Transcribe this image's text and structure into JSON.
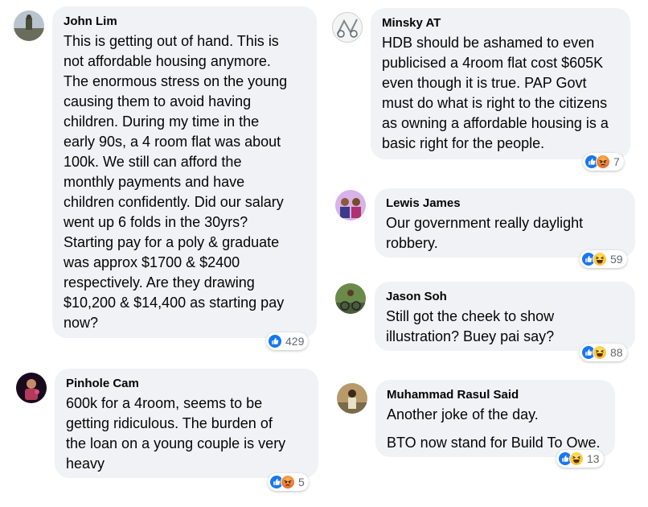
{
  "comments": [
    {
      "name": "John Lim",
      "text": "This is getting out of hand. This is\nnot affordable housing anymore.\nThe enormous stress on the young\ncausing them to avoid having\nchildren. During my time in the\nearly 90s, a 4 room flat was about\n100k. We still can afford the\nmonthly payments and have\nchildren confidently. Did our salary\nwent up 6 folds in the 30yrs?\nStarting pay for a poly & graduate\nwas approx $1700 & $2400\nrespectively. Are they drawing\n$10,200 & $14,400 as starting pay\nnow?",
      "reaction_count": "429"
    },
    {
      "name": "Pinhole Cam",
      "text": "600k for a 4room, seems to be\ngetting ridiculous. The burden of\nthe loan on a young couple is very\nheavy",
      "reaction_count": "5"
    },
    {
      "name": "Minsky AT",
      "text": "HDB should be ashamed to even\npublicised a 4room flat cost $605K\neven though it is true. PAP Govt\nmust do what is right to the citizens\nas owning a affordable housing is a\nbasic right for the people.",
      "reaction_count": "7"
    },
    {
      "name": "Lewis James",
      "text": "Our government really daylight\nrobbery.",
      "reaction_count": "59"
    },
    {
      "name": "Jason Soh",
      "text": "Still got the cheek to show\nillustration? Buey pai say?",
      "reaction_count": "88"
    },
    {
      "name": "Muhammad Rasul Said",
      "text": "Another joke of the day.",
      "text2": "BTO now stand for Build To Owe.",
      "reaction_count": "13"
    }
  ],
  "icons": {
    "like": "like-icon",
    "angry": "angry-icon",
    "haha": "haha-icon"
  },
  "colors": {
    "bubble": "#f0f2f5",
    "like": "#1877f2",
    "meta_text": "#65676b"
  }
}
